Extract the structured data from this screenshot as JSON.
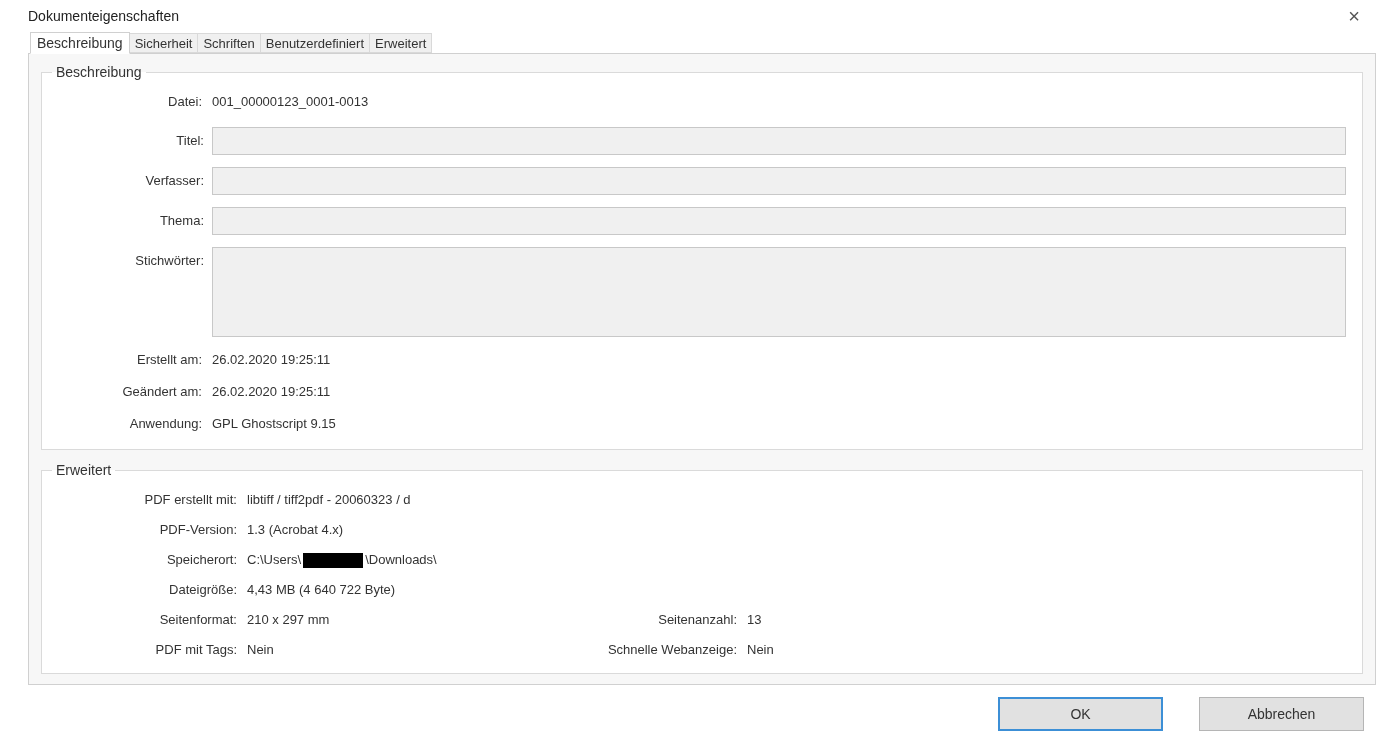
{
  "window": {
    "title": "Dokumenteigenschaften",
    "close": "×"
  },
  "tabs": [
    {
      "label": "Beschreibung",
      "selected": true
    },
    {
      "label": "Sicherheit",
      "selected": false
    },
    {
      "label": "Schriften",
      "selected": false
    },
    {
      "label": "Benutzerdefiniert",
      "selected": false
    },
    {
      "label": "Erweitert",
      "selected": false
    }
  ],
  "description": {
    "title": "Beschreibung",
    "file": {
      "label": "Datei:",
      "value": "001_00000123_0001-0013"
    },
    "fields": [
      {
        "label": "Titel:",
        "kind": "line"
      },
      {
        "label": "Verfasser:",
        "kind": "line"
      },
      {
        "label": "Thema:",
        "kind": "line"
      },
      {
        "label": "Stichwörter:",
        "kind": "multiline"
      }
    ],
    "info": [
      {
        "label": "Erstellt am:",
        "value": "26.02.2020 19:25:11"
      },
      {
        "label": "Geändert am:",
        "value": "26.02.2020 19:25:11"
      },
      {
        "label": "Anwendung:",
        "value": "GPL Ghostscript 9.15"
      }
    ]
  },
  "advanced": {
    "title": "Erweitert",
    "rows": [
      {
        "label": "PDF erstellt mit:",
        "value": "libtiff / tiff2pdf - 20060323 / d"
      },
      {
        "label": "PDF-Version:",
        "value": "1.3 (Acrobat 4.x)"
      },
      {
        "label": "Speicherort:",
        "value": "C:\\Users\\",
        "redacted": true,
        "value_after": "\\Downloads\\"
      },
      {
        "label": "Dateigröße:",
        "value": "4,43 MB (4 640 722 Byte)"
      },
      {
        "label": "Seitenformat:",
        "value": "210 x 297 mm",
        "right_label": "Seitenanzahl:",
        "right_value": "13"
      },
      {
        "label": "PDF mit Tags:",
        "value": "Nein",
        "right_label": "Schnelle Webanzeige:",
        "right_value": "Nein"
      }
    ]
  },
  "buttons": [
    {
      "label": "OK",
      "default": true
    },
    {
      "label": "Abbrechen",
      "default": false
    }
  ]
}
